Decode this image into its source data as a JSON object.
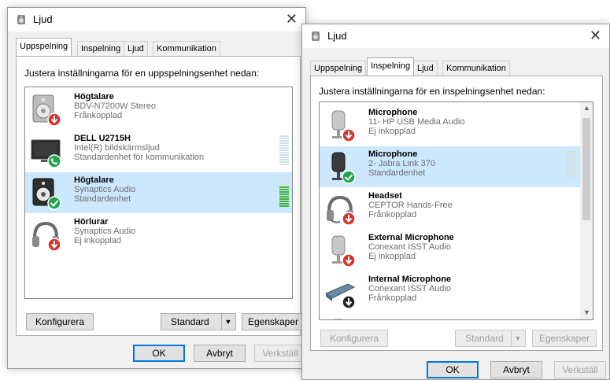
{
  "colors": {
    "selection": "#cce8ff",
    "accent": "#0078d7",
    "ok_green": "#22a44a",
    "status_red": "#d9342b"
  },
  "dialog1": {
    "title": "Ljud",
    "tabs": [
      "Uppspelning",
      "Inspelning",
      "Ljud",
      "Kommunikation"
    ],
    "instruction": "Justera inställningarna för en uppspelningsenhet nedan:",
    "devices": [
      {
        "name": "Högtalare",
        "line1": "BDV-N7200W Stereo",
        "line2": "Frånkopplad",
        "icon": "speaker-icon",
        "badge": "disconnected-badge-icon"
      },
      {
        "name": "DELL U2715H",
        "line1": "Intel(R) bildskärmsljud",
        "line2": "Standardenhet för kommunikation",
        "icon": "monitor-icon",
        "badge": "phone-badge-icon"
      },
      {
        "name": "Högtalare",
        "line1": "Synaptics Audio",
        "line2": "Standardenhet",
        "icon": "speaker-icon",
        "badge": "default-check-badge-icon"
      },
      {
        "name": "Hörlurar",
        "line1": "Synaptics Audio",
        "line2": "Ej inkopplad",
        "icon": "headphones-icon",
        "badge": "disconnected-badge-icon"
      }
    ],
    "buttons": {
      "configure": "Konfigurera",
      "standard": "Standard",
      "properties": "Egenskaper",
      "ok": "OK",
      "cancel": "Avbryt",
      "apply": "Verkställ"
    }
  },
  "dialog2": {
    "title": "Ljud",
    "tabs": [
      "Uppspelning",
      "Inspelning",
      "Ljud",
      "Kommunikation"
    ],
    "instruction": "Justera inställningarna för en inspelningsenhet nedan:",
    "devices": [
      {
        "name": "Microphone",
        "line1": "11- HP USB Media Audio",
        "line2": "Ej inkopplad",
        "icon": "microphone-icon",
        "badge": "disconnected-badge-icon"
      },
      {
        "name": "Microphone",
        "line1": "2- Jabra Link 370",
        "line2": "Standardenhet",
        "icon": "microphone-icon",
        "badge": "default-check-badge-icon"
      },
      {
        "name": "Headset",
        "line1": "CEPTOR Hands-Free",
        "line2": "Frånkopplad",
        "icon": "headset-icon",
        "badge": "disconnected-badge-icon"
      },
      {
        "name": "External Microphone",
        "line1": "Conexant ISST Audio",
        "line2": "Ej inkopplad",
        "icon": "microphone-icon",
        "badge": "disconnected-badge-icon"
      },
      {
        "name": "Internal Microphone",
        "line1": "Conexant ISST Audio",
        "line2": "Frånkopplad",
        "icon": "internal-microphone-icon",
        "badge": "disconnected-badge-icon"
      }
    ],
    "buttons": {
      "configure": "Konfigurera",
      "standard": "Standard",
      "properties": "Egenskaper",
      "ok": "OK",
      "cancel": "Avbryt",
      "apply": "Verkställ"
    }
  }
}
